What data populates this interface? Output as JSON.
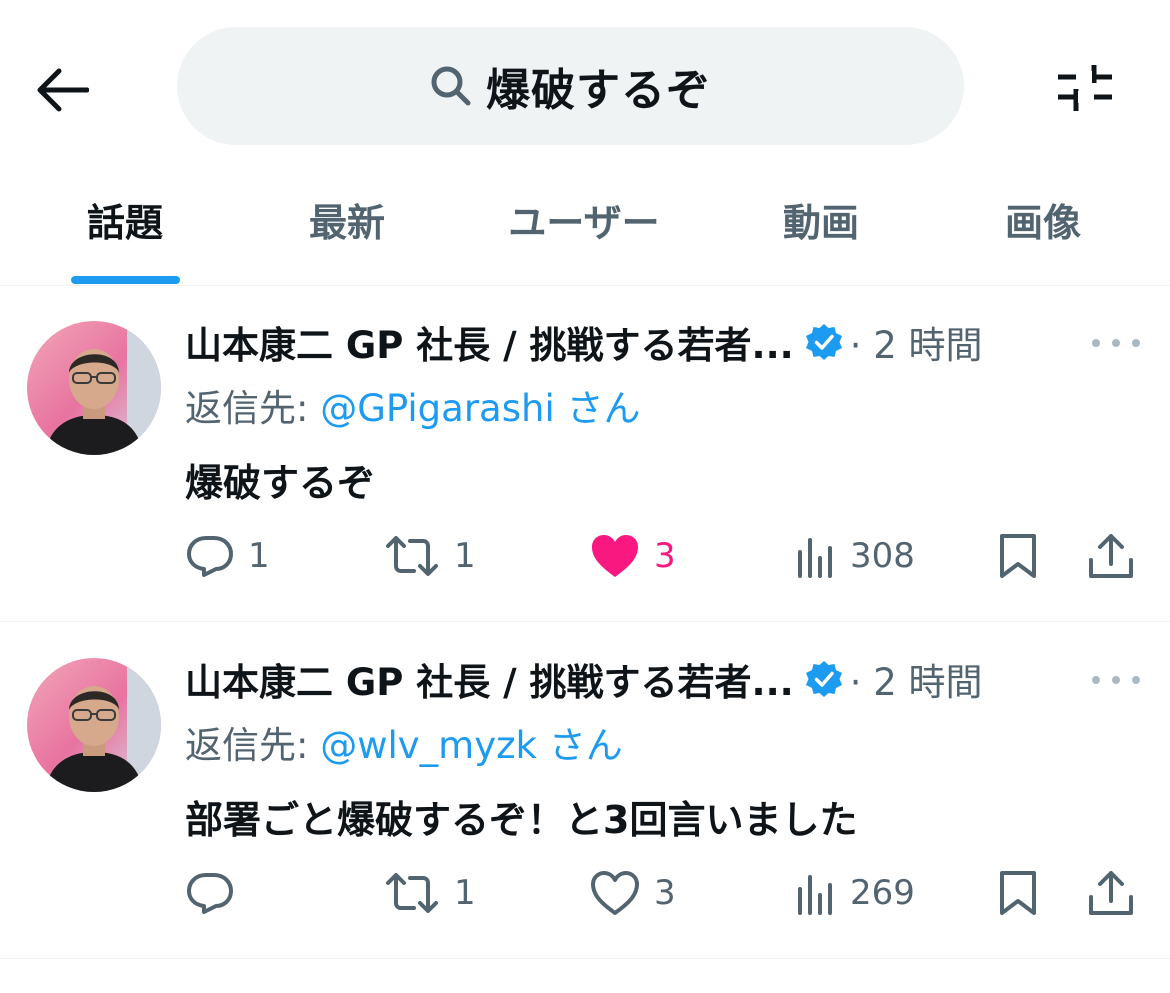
{
  "search": {
    "query": "爆破するぞ"
  },
  "tabs": [
    {
      "label": "話題",
      "active": true
    },
    {
      "label": "最新"
    },
    {
      "label": "ユーザー"
    },
    {
      "label": "動画"
    },
    {
      "label": "画像"
    }
  ],
  "tweets": [
    {
      "name": "山本康二 GP 社長 / 挑戦する若者...",
      "time": "· 2 時間",
      "reply_prefix": "返信先: ",
      "reply_handle": "@GPigarashi",
      "reply_suffix": " さん",
      "text": "爆破するぞ",
      "replies": "1",
      "retweets": "1",
      "likes": "3",
      "liked": true,
      "views": "308"
    },
    {
      "name": "山本康二 GP 社長 / 挑戦する若者...",
      "time": "· 2 時間",
      "reply_prefix": "返信先: ",
      "reply_handle": "@wlv_myzk",
      "reply_suffix": " さん",
      "text": "部署ごと爆破するぞ！と3回言いました",
      "replies": "",
      "retweets": "1",
      "likes": "3",
      "liked": false,
      "views": "269"
    }
  ],
  "colors": {
    "accent": "#1d9bf0",
    "like": "#f91880",
    "muted": "#536471",
    "search_bg": "#eff3f4"
  }
}
